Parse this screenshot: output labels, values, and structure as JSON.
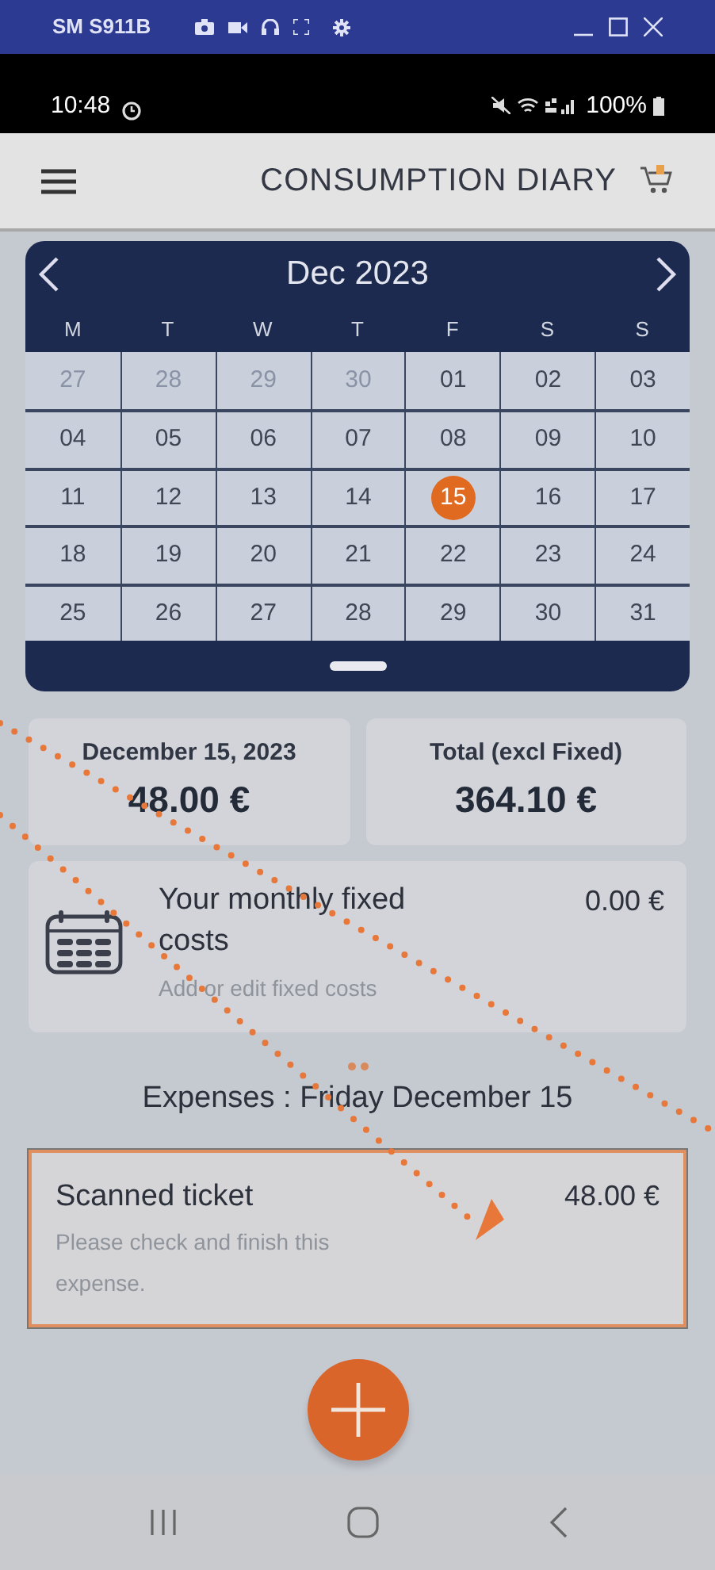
{
  "window": {
    "title": "SM S911B"
  },
  "status_bar": {
    "time": "10:48",
    "battery": "100%"
  },
  "header": {
    "title": "CONSUMPTION DIARY"
  },
  "calendar": {
    "month": "Dec 2023",
    "weekdays": [
      "M",
      "T",
      "W",
      "T",
      "F",
      "S",
      "S"
    ],
    "weeks": [
      [
        {
          "day": "27",
          "outside": true,
          "selected": false
        },
        {
          "day": "28",
          "outside": true,
          "selected": false
        },
        {
          "day": "29",
          "outside": true,
          "selected": false
        },
        {
          "day": "30",
          "outside": true,
          "selected": false
        },
        {
          "day": "01",
          "outside": false,
          "selected": false
        },
        {
          "day": "02",
          "outside": false,
          "selected": false
        },
        {
          "day": "03",
          "outside": false,
          "selected": false
        }
      ],
      [
        {
          "day": "04",
          "outside": false,
          "selected": false
        },
        {
          "day": "05",
          "outside": false,
          "selected": false
        },
        {
          "day": "06",
          "outside": false,
          "selected": false
        },
        {
          "day": "07",
          "outside": false,
          "selected": false
        },
        {
          "day": "08",
          "outside": false,
          "selected": false
        },
        {
          "day": "09",
          "outside": false,
          "selected": false
        },
        {
          "day": "10",
          "outside": false,
          "selected": false
        }
      ],
      [
        {
          "day": "11",
          "outside": false,
          "selected": false
        },
        {
          "day": "12",
          "outside": false,
          "selected": false
        },
        {
          "day": "13",
          "outside": false,
          "selected": false
        },
        {
          "day": "14",
          "outside": false,
          "selected": false
        },
        {
          "day": "15",
          "outside": false,
          "selected": true
        },
        {
          "day": "16",
          "outside": false,
          "selected": false
        },
        {
          "day": "17",
          "outside": false,
          "selected": false
        }
      ],
      [
        {
          "day": "18",
          "outside": false,
          "selected": false
        },
        {
          "day": "19",
          "outside": false,
          "selected": false
        },
        {
          "day": "20",
          "outside": false,
          "selected": false
        },
        {
          "day": "21",
          "outside": false,
          "selected": false
        },
        {
          "day": "22",
          "outside": false,
          "selected": false
        },
        {
          "day": "23",
          "outside": false,
          "selected": false
        },
        {
          "day": "24",
          "outside": false,
          "selected": false
        }
      ],
      [
        {
          "day": "25",
          "outside": false,
          "selected": false
        },
        {
          "day": "26",
          "outside": false,
          "selected": false
        },
        {
          "day": "27",
          "outside": false,
          "selected": false
        },
        {
          "day": "28",
          "outside": false,
          "selected": false
        },
        {
          "day": "29",
          "outside": false,
          "selected": false
        },
        {
          "day": "30",
          "outside": false,
          "selected": false
        },
        {
          "day": "31",
          "outside": false,
          "selected": false
        }
      ]
    ]
  },
  "summary": [
    {
      "label": "December 15, 2023",
      "value": "48.00 €"
    },
    {
      "label": "Total (excl Fixed)",
      "value": "364.10 €"
    }
  ],
  "fixed_costs": {
    "title": "Your monthly fixed costs",
    "amount": "0.00 €",
    "link": "Add or edit fixed costs"
  },
  "expenses": {
    "heading": "Expenses : Friday December 15",
    "items": [
      {
        "title": "Scanned ticket",
        "amount": "48.00 €",
        "note": "Please check and finish this expense."
      }
    ]
  }
}
